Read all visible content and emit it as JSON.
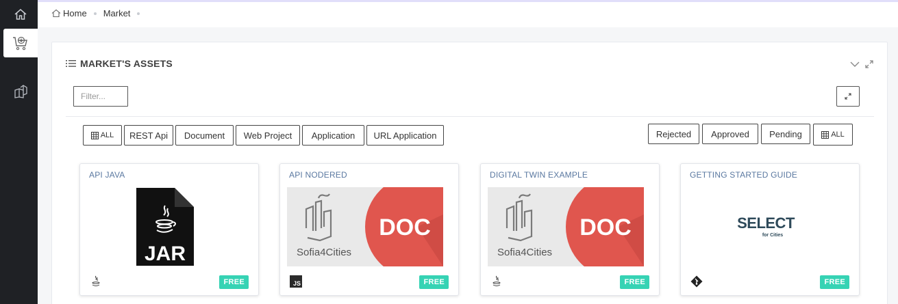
{
  "sidebar": {
    "items": [
      {
        "icon": "home-icon"
      },
      {
        "icon": "market-cart-icon",
        "active": true
      },
      {
        "icon": "boxes-icon"
      }
    ]
  },
  "breadcrumb": [
    "Home",
    "Market"
  ],
  "portlet": {
    "title": "MARKET'S ASSETS",
    "filter_placeholder": "Filter..."
  },
  "type_filters": [
    "ALL",
    "REST Api",
    "Document",
    "Web Project",
    "Application",
    "URL Application"
  ],
  "state_filters": [
    "Rejected",
    "Approved",
    "Pending",
    "ALL"
  ],
  "cards": [
    {
      "title": "API JAVA",
      "image": "jar-file-image",
      "icon": "java-icon",
      "badge": "FREE"
    },
    {
      "title": "API NODERED",
      "image": "sofia-doc-image",
      "image_caption": "Sofia4Cities",
      "image_label": "DOC",
      "icon": "js-icon",
      "icon_text": "JS",
      "badge": "FREE"
    },
    {
      "title": "DIGITAL TWIN EXAMPLE",
      "image": "sofia-doc-image",
      "image_caption": "Sofia4Cities",
      "image_label": "DOC",
      "icon": "java-icon",
      "badge": "FREE"
    },
    {
      "title": "GETTING STARTED GUIDE",
      "image": "select-logo-image",
      "image_label": "SELECT",
      "image_sub": "for Cities",
      "icon": "git-icon",
      "badge": "FREE"
    }
  ],
  "colors": {
    "sidebar": "#1f2125",
    "link": "#5a78a0",
    "badge": "#36d3b4",
    "doc_red": "#e0564e"
  }
}
